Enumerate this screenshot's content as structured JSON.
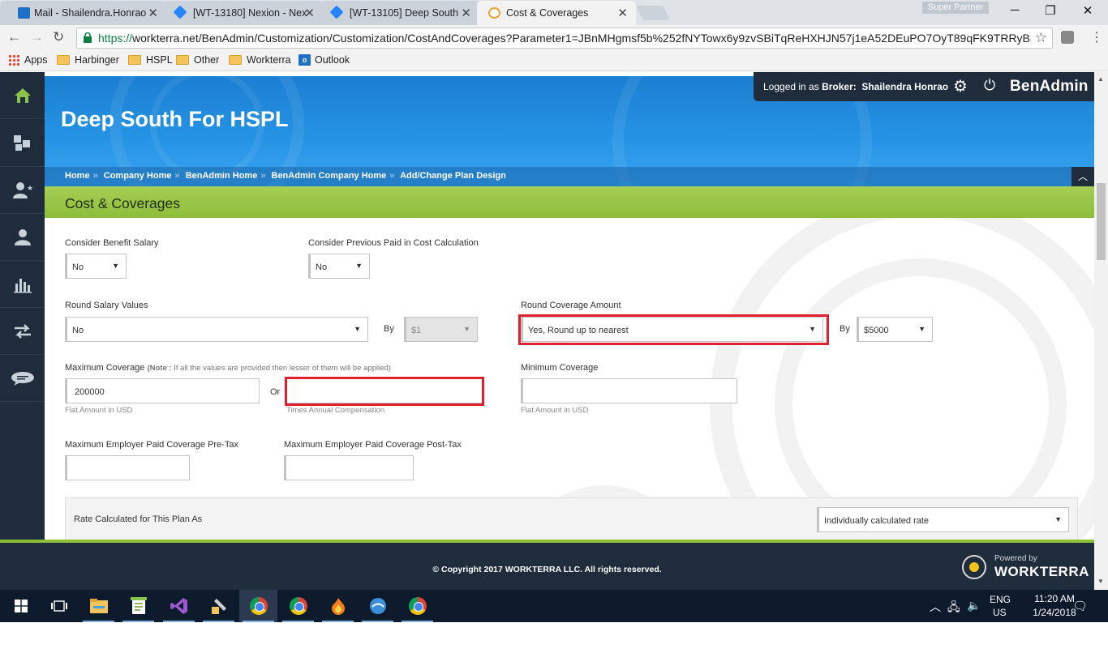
{
  "browser": {
    "tabs": [
      {
        "label": "Mail - Shailendra.Honrao",
        "favicon_color": "#1f6fc5"
      },
      {
        "label": "[WT-13180] Nexion - Nex",
        "favicon_color": "#2684ff"
      },
      {
        "label": "[WT-13105] Deep South",
        "favicon_color": "#2684ff"
      },
      {
        "label": "Cost & Coverages",
        "favicon_color": "#e8a23a"
      }
    ],
    "profile_label": "Super Partner",
    "url_scheme": "https://",
    "url_rest": "workterra.net/BenAdmin/Customization/Customization/CostAndCoverages?Parameter1=JBnMHgmsf5b%252fNYTowx6y9zvSBiTqReHXHJN57j1eA52DEuPO7OyT89qFK9TRRyBmiyh",
    "bookmarks": [
      "Apps",
      "Harbinger",
      "HSPL",
      "Other",
      "Workterra",
      "Outlook"
    ]
  },
  "header": {
    "company_name": "Deep South For HSPL",
    "login_prefix": "Logged in as ",
    "login_role": "Broker:",
    "login_user": "Shailendra Honrao",
    "app_name": "BenAdmin",
    "breadcrumbs": [
      "Home",
      "Company Home",
      "BenAdmin Home",
      "BenAdmin Company Home",
      "Add/Change Plan Design"
    ]
  },
  "page": {
    "title": "Cost & Coverages"
  },
  "form": {
    "consider_benefit_salary": {
      "label": "Consider Benefit Salary",
      "value": "No"
    },
    "consider_previous_paid": {
      "label": "Consider Previous Paid in Cost Calculation",
      "value": "No"
    },
    "round_salary_values": {
      "label": "Round Salary Values",
      "value": "No"
    },
    "round_salary_by": {
      "label": "By",
      "value": "$1"
    },
    "round_coverage_amount": {
      "label": "Round Coverage Amount",
      "value": "Yes, Round up to nearest"
    },
    "round_coverage_by": {
      "label": "By",
      "value": "$5000"
    },
    "max_coverage": {
      "label": "Maximum Coverage",
      "note_prefix": "(Note :",
      "note_text": " If all the values are provided then lesser of them will be applied)",
      "value": "200000",
      "hint": "Flat Amount in USD",
      "or_label": "Or",
      "times_value": "",
      "times_hint": "Times Annual Compensation"
    },
    "min_coverage": {
      "label": "Minimum Coverage",
      "value": "",
      "hint": "Flat Amount in USD"
    },
    "max_employer_pretax": {
      "label": "Maximum Employer Paid Coverage Pre-Tax",
      "value": ""
    },
    "max_employer_posttax": {
      "label": "Maximum Employer Paid Coverage Post-Tax",
      "value": ""
    },
    "rate_calculated": {
      "label": "Rate Calculated for This Plan As",
      "value": "Individually calculated rate"
    }
  },
  "footer": {
    "copyright": "© Copyright 2017 WORKTERRA LLC. All rights reserved.",
    "powered_by": "Powered by",
    "brand": "WORKTERRA"
  },
  "taskbar": {
    "lang_line1": "ENG",
    "lang_line2": "US",
    "time": "11:20 AM",
    "date": "1/24/2018"
  },
  "colors": {
    "accent_blue": "#2593e4",
    "accent_green": "#8ebd3a",
    "dark_navy": "#1e2c3b",
    "highlight_red": "#e0202e"
  }
}
